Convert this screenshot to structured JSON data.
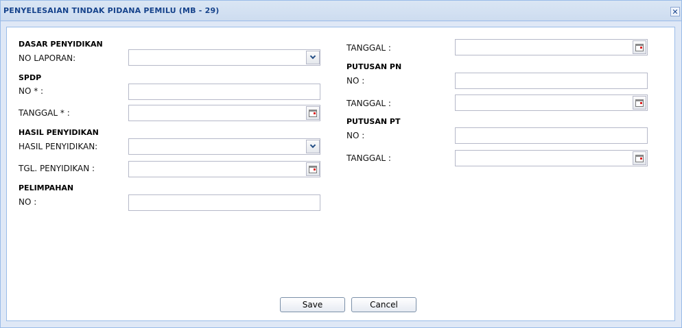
{
  "window": {
    "title": "PENYELESAIAN TINDAK PIDANA PEMILU (MB - 29)"
  },
  "icons": {
    "close": "close-icon",
    "dropdown": "chevron-down-icon",
    "date": "calendar-icon"
  },
  "left": {
    "dasar": {
      "header": "DASAR PENYIDIKAN",
      "no_laporan_label": "NO LAPORAN:",
      "no_laporan_value": ""
    },
    "spdp": {
      "header": "SPDP",
      "no_label": "NO * :",
      "no_value": "",
      "tanggal_label": "TANGGAL * :",
      "tanggal_value": ""
    },
    "hasil": {
      "header": "HASIL PENYIDIKAN",
      "hasil_label": "HASIL PENYIDIKAN:",
      "hasil_value": "",
      "tgl_label": "TGL. PENYIDIKAN :",
      "tgl_value": ""
    },
    "pelimpahan": {
      "header": "PELIMPAHAN",
      "no_label": "NO :",
      "no_value": ""
    }
  },
  "right": {
    "top": {
      "tanggal_label": "TANGGAL :",
      "tanggal_value": ""
    },
    "pn": {
      "header": "PUTUSAN PN",
      "no_label": "NO :",
      "no_value": "",
      "tanggal_label": "TANGGAL :",
      "tanggal_value": ""
    },
    "pt": {
      "header": "PUTUSAN PT",
      "no_label": "NO :",
      "no_value": "",
      "tanggal_label": "TANGGAL :",
      "tanggal_value": ""
    }
  },
  "buttons": {
    "save": "Save",
    "cancel": "Cancel"
  },
  "colors": {
    "title_text": "#15428b",
    "border": "#99bbe8",
    "window_bg": "#dfe8f6"
  }
}
